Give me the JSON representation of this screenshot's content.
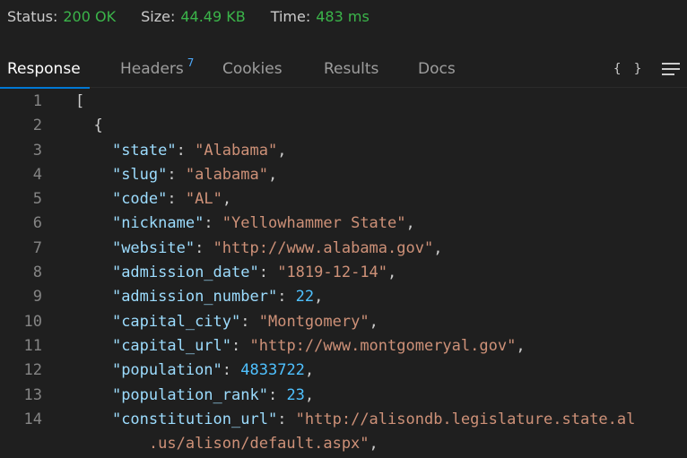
{
  "status": {
    "status_label": "Status:",
    "status_value": "200 OK",
    "size_label": "Size:",
    "size_value": "44.49 KB",
    "time_label": "Time:",
    "time_value": "483 ms"
  },
  "tabs": {
    "response": "Response",
    "headers": "Headers",
    "headers_count": "7",
    "cookies": "Cookies",
    "results": "Results",
    "docs": "Docs",
    "braces_icon": "{ }",
    "menu_icon": "menu-icon"
  },
  "colors": {
    "accent": "#0078d4",
    "status_green": "#3bb54a",
    "key": "#9cdcfe",
    "string": "#ce9178",
    "number": "#4fc1ff"
  },
  "code": {
    "lines": [
      {
        "num": "1",
        "text": "["
      },
      {
        "num": "2",
        "text": "  {"
      },
      {
        "num": "3",
        "key": "\"state\"",
        "value": "\"Alabama\"",
        "type": "string"
      },
      {
        "num": "4",
        "key": "\"slug\"",
        "value": "\"alabama\"",
        "type": "string"
      },
      {
        "num": "5",
        "key": "\"code\"",
        "value": "\"AL\"",
        "type": "string"
      },
      {
        "num": "6",
        "key": "\"nickname\"",
        "value": "\"Yellowhammer State\"",
        "type": "string"
      },
      {
        "num": "7",
        "key": "\"website\"",
        "value": "\"http://www.alabama.gov\"",
        "type": "string"
      },
      {
        "num": "8",
        "key": "\"admission_date\"",
        "value": "\"1819-12-14\"",
        "type": "string"
      },
      {
        "num": "9",
        "key": "\"admission_number\"",
        "value": "22",
        "type": "number"
      },
      {
        "num": "10",
        "key": "\"capital_city\"",
        "value": "\"Montgomery\"",
        "type": "string"
      },
      {
        "num": "11",
        "key": "\"capital_url\"",
        "value": "\"http://www.montgomeryal.gov\"",
        "type": "string"
      },
      {
        "num": "12",
        "key": "\"population\"",
        "value": "4833722",
        "type": "number"
      },
      {
        "num": "13",
        "key": "\"population_rank\"",
        "value": "23",
        "type": "number"
      },
      {
        "num": "14",
        "key": "\"constitution_url\"",
        "value": "\"http://alisondb.legislature.state.al",
        "type": "string-open"
      },
      {
        "num": "",
        "continuation": ".us/alison/default.aspx\","
      }
    ]
  }
}
